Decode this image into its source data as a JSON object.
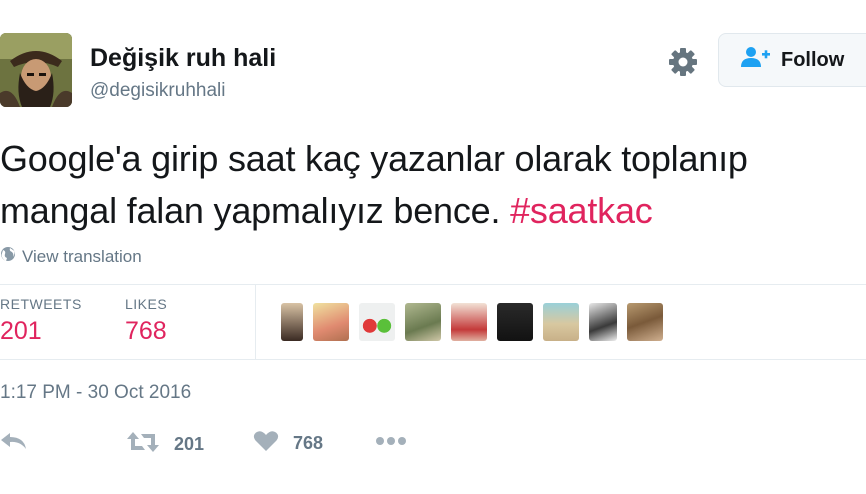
{
  "user": {
    "display_name": "Değişik ruh hali",
    "handle": "@degisikruhhali"
  },
  "follow_button": {
    "label": "Follow"
  },
  "tweet": {
    "line1": "Google'a girip saat kaç yazanlar olarak toplanıp",
    "line2_text": "mangal falan yapmalıyız bence. ",
    "hashtag": "#saatkac"
  },
  "translation": {
    "label": "View translation"
  },
  "stats": {
    "retweets_label": "RETWEETS",
    "retweets_value": "201",
    "likes_label": "LIKES",
    "likes_value": "768"
  },
  "timestamp": "1:17 PM - 30 Oct 2016",
  "actions": {
    "retweet_count": "201",
    "like_count": "768"
  },
  "colors": {
    "accent_pink": "#e0245e",
    "secondary_gray": "#657786",
    "follow_icon_blue": "#1da1f2"
  },
  "icons": [
    "gear-icon",
    "follow-user-icon",
    "globe-icon",
    "reply-icon",
    "retweet-icon",
    "heart-icon",
    "more-icon"
  ]
}
